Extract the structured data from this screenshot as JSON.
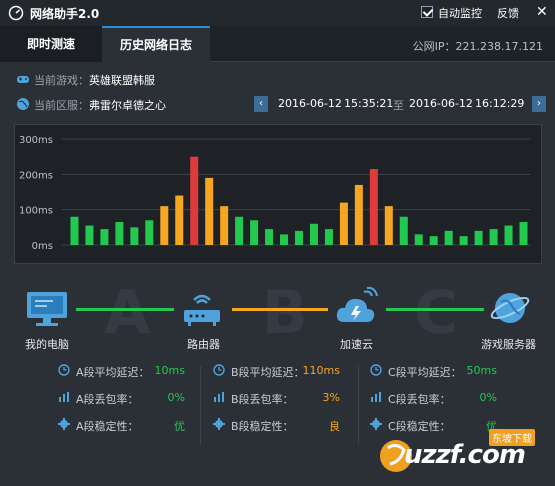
{
  "window": {
    "title": "网络助手2.0",
    "auto_monitor_label": "自动监控",
    "auto_monitor_checked": true,
    "feedback_label": "反馈",
    "close_symbol": "✕"
  },
  "tabs": [
    {
      "label": "即时测速",
      "active": false
    },
    {
      "label": "历史网络日志",
      "active": true
    }
  ],
  "public_ip": "公网IP：221.238.17.121",
  "current_game": {
    "label": "当前游戏：",
    "value": "英雄联盟韩服"
  },
  "current_region": {
    "label": "当前区服：",
    "value": "弗雷尔卓德之心"
  },
  "time_range": {
    "start_date": "2016-06-12",
    "start_time": "15:35:21",
    "separator": "至",
    "end_date": "2016-06-12",
    "end_time": "16:12:29",
    "prev_symbol": "‹",
    "next_symbol": "›"
  },
  "chart_data": {
    "type": "bar",
    "title": "",
    "xlabel": "",
    "ylabel": "",
    "ytick_labels": [
      "300ms",
      "200ms",
      "100ms",
      "0ms"
    ],
    "ylim": [
      0,
      300
    ],
    "grid": true,
    "values": [
      80,
      55,
      45,
      65,
      50,
      70,
      110,
      140,
      250,
      190,
      110,
      80,
      70,
      45,
      30,
      40,
      60,
      45,
      120,
      170,
      215,
      110,
      80,
      30,
      25,
      40,
      25,
      40,
      45,
      55,
      65
    ],
    "colors_by_threshold": {
      "green": "#23c94f",
      "orange": "#f5a623",
      "red": "#e03b3b"
    }
  },
  "nodes": [
    {
      "label": "我的电脑",
      "icon": "computer-icon"
    },
    {
      "label": "路由器",
      "icon": "router-icon"
    },
    {
      "label": "加速云",
      "icon": "cloud-icon"
    },
    {
      "label": "游戏服务器",
      "icon": "game-server-icon"
    }
  ],
  "segments": [
    {
      "letter": "A",
      "color": "#23c94f"
    },
    {
      "letter": "B",
      "color": "#f5a623"
    },
    {
      "letter": "C",
      "color": "#23c94f"
    }
  ],
  "stats": [
    {
      "avg_latency_label": "A段平均延迟：",
      "avg_latency_value": "10ms",
      "latency_color": "#23c94f",
      "loss_label": "A段丢包率：",
      "loss_value": "0%",
      "loss_color": "#23c94f",
      "stability_label": "A段稳定性：",
      "stability_value": "优",
      "stability_color": "#23c94f"
    },
    {
      "avg_latency_label": "B段平均延迟：",
      "avg_latency_value": "110ms",
      "latency_color": "#f5a623",
      "loss_label": "B段丢包率：",
      "loss_value": "3%",
      "loss_color": "#f5a623",
      "stability_label": "B段稳定性：",
      "stability_value": "良",
      "stability_color": "#f5a623"
    },
    {
      "avg_latency_label": "C段平均延迟：",
      "avg_latency_value": "50ms",
      "latency_color": "#23c94f",
      "loss_label": "C段丢包率：",
      "loss_value": "0%",
      "loss_color": "#23c94f",
      "stability_label": "C段稳定性：",
      "stability_value": "优",
      "stability_color": "#23c94f"
    }
  ],
  "watermark": {
    "text": "uzzf.com",
    "tag": "东坡下载"
  }
}
